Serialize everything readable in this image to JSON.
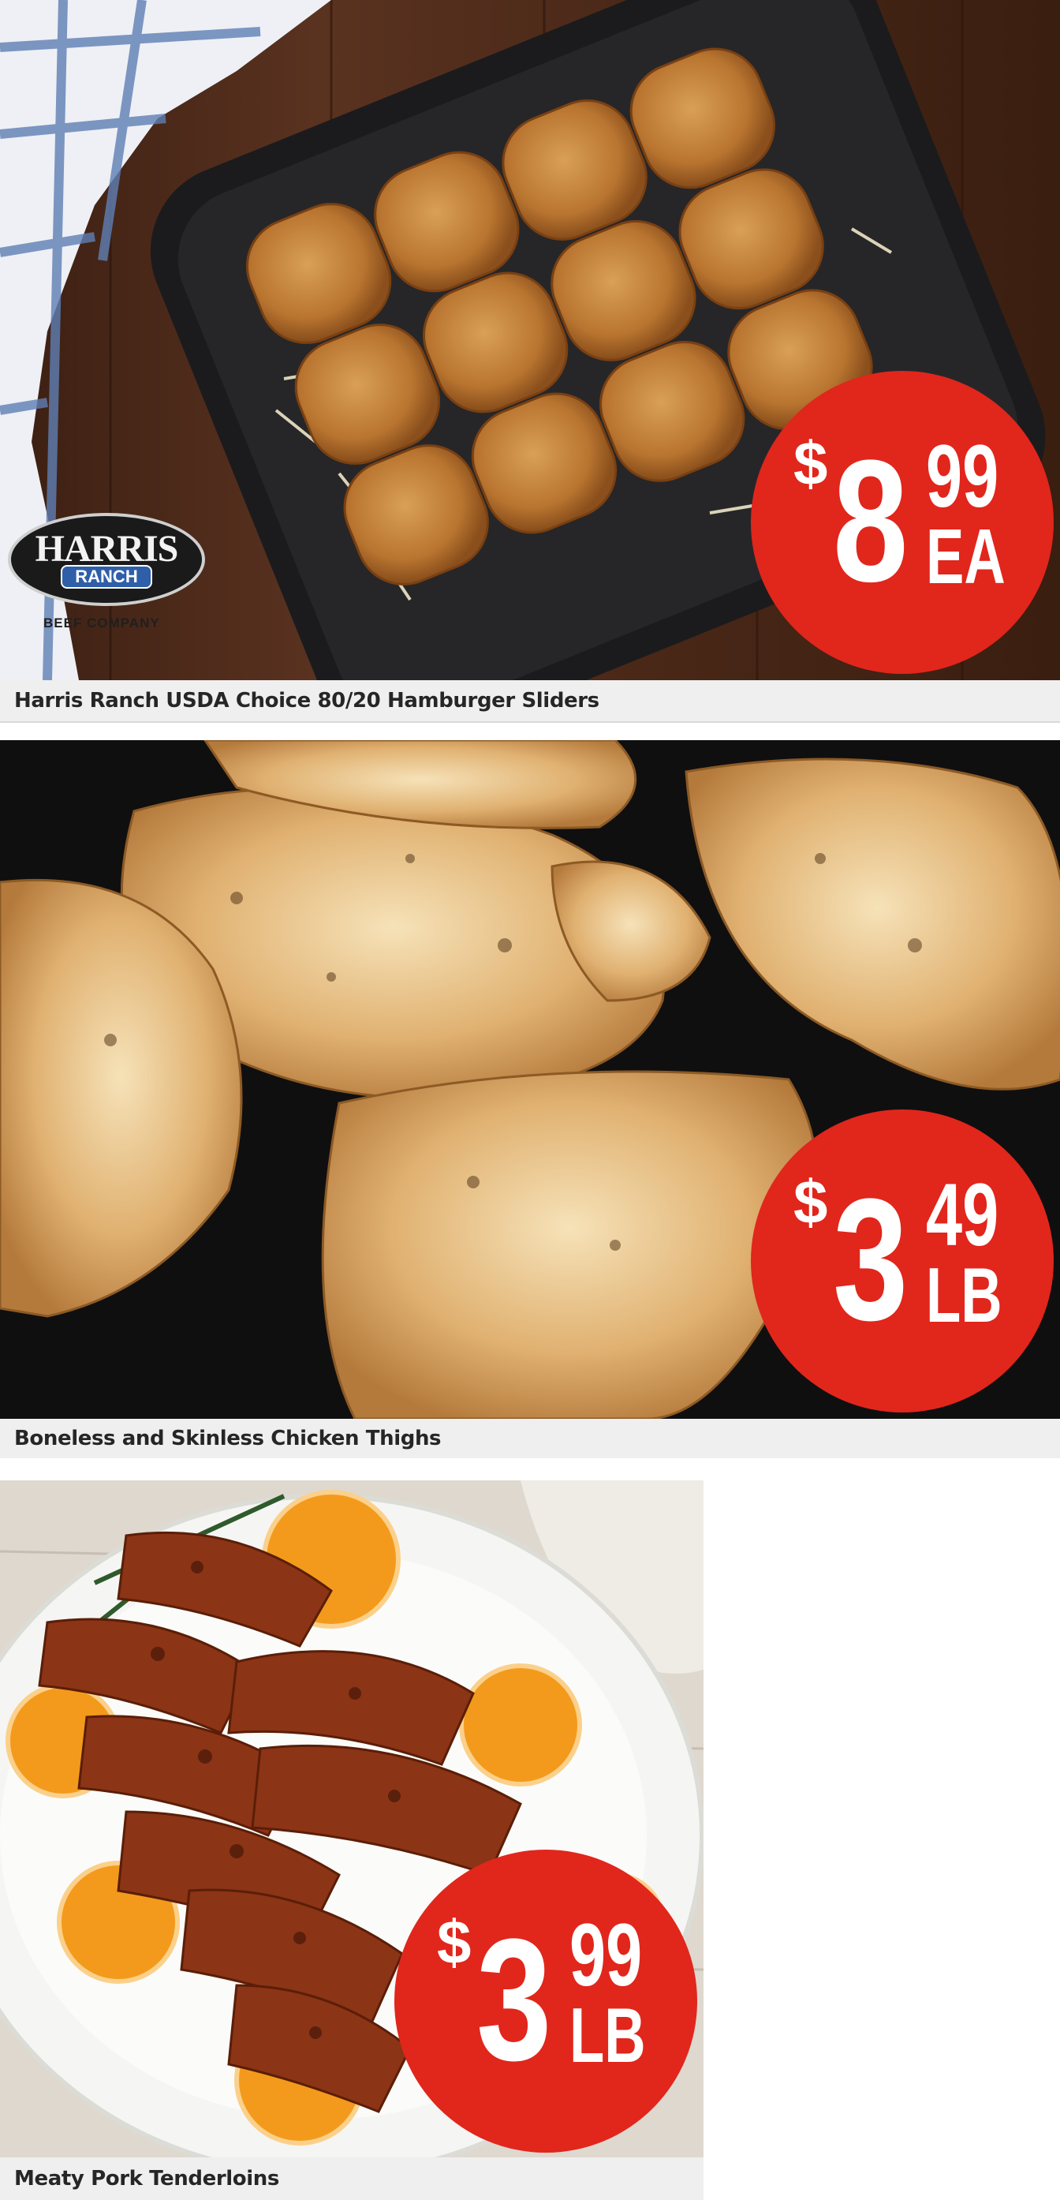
{
  "products": [
    {
      "name": "Harris Ranch USDA Choice 80/20 Hamburger Sliders",
      "price": {
        "currency": "$",
        "dollars": "8",
        "cents": "99",
        "unit": "EA"
      },
      "image": "hamburger-sliders-photo",
      "brand_logo": {
        "name": "HARRIS",
        "sub": "RANCH",
        "tagline": "BEEF COMPANY"
      }
    },
    {
      "name": "Boneless and Skinless Chicken Thighs",
      "price": {
        "currency": "$",
        "dollars": "3",
        "cents": "49",
        "unit": "LB"
      },
      "image": "chicken-thighs-photo"
    },
    {
      "name": "Meaty Pork Tenderloins",
      "price": {
        "currency": "$",
        "dollars": "3",
        "cents": "99",
        "unit": "LB"
      },
      "image": "pork-tenderloin-photo"
    }
  ],
  "colors": {
    "badge": "#e1261c",
    "caption_bg": "#efefef",
    "caption_text": "#262626"
  }
}
